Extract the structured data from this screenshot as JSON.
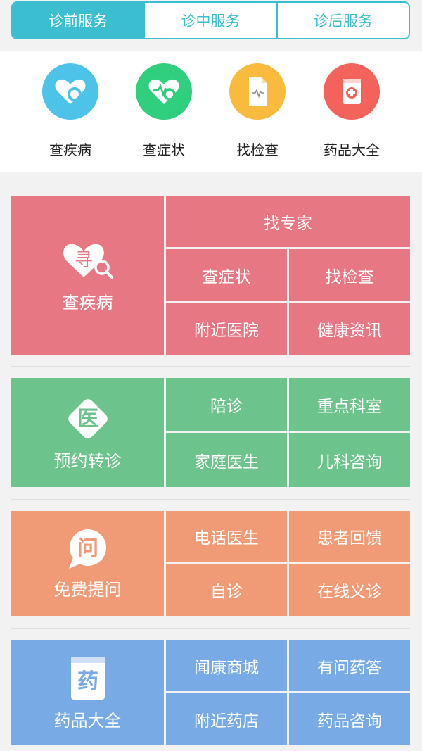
{
  "tabs": [
    {
      "label": "诊前服务",
      "active": true
    },
    {
      "label": "诊中服务",
      "active": false
    },
    {
      "label": "诊后服务",
      "active": false
    }
  ],
  "quick": [
    {
      "label": "查疾病",
      "color": "#4dc3e9",
      "icon": "heart-search-icon"
    },
    {
      "label": "查症状",
      "color": "#2fcf7d",
      "icon": "pulse-heart-search-icon"
    },
    {
      "label": "找检查",
      "color": "#f9bb3d",
      "icon": "document-pulse-icon"
    },
    {
      "label": "药品大全",
      "color": "#f4625c",
      "icon": "medicine-book-icon"
    }
  ],
  "sections": {
    "disease": {
      "color": "#e87784",
      "title": "查疾病",
      "icon_text": "寻",
      "top": "找专家",
      "cells": [
        "查症状",
        "找检查",
        "附近医院",
        "健康资讯"
      ]
    },
    "referral": {
      "color": "#6cc38c",
      "title": "预约转诊",
      "icon_text": "医",
      "cells": [
        "陪诊",
        "重点科室",
        "家庭医生",
        "儿科咨询"
      ]
    },
    "ask": {
      "color": "#f09b76",
      "title": "免费提问",
      "icon_text": "问",
      "cells": [
        "电话医生",
        "患者回馈",
        "自诊",
        "在线义诊"
      ]
    },
    "drugs": {
      "color": "#78abe6",
      "title": "药品大全",
      "icon_text": "药",
      "cells": [
        "闻康商城",
        "有问药答",
        "附近药店",
        "药品咨询"
      ]
    }
  }
}
